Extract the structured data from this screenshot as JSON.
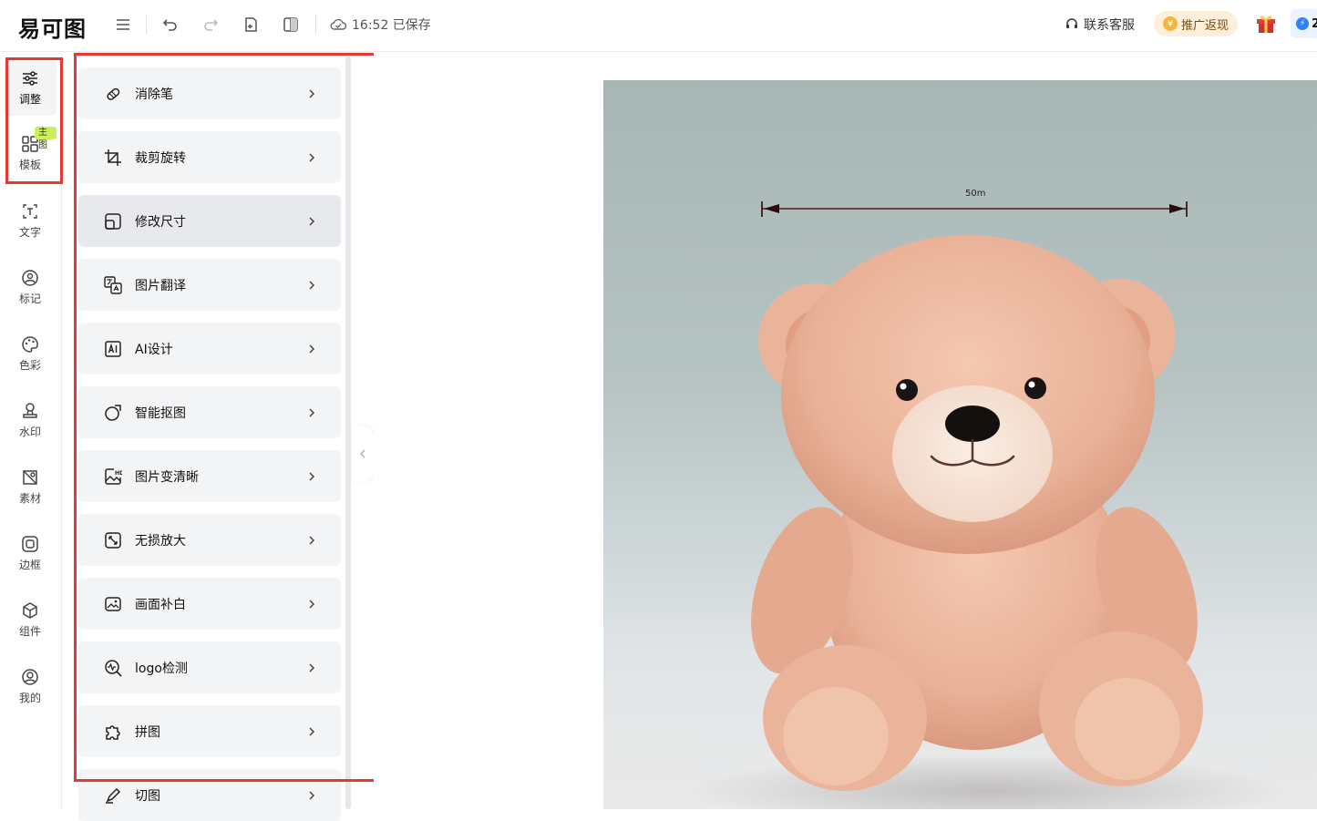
{
  "topbar": {
    "logo": "易可图",
    "save_time": "16:52 已保存",
    "support_label": "联系客服",
    "promo_label": "推广返现",
    "vip_number": "2"
  },
  "rail": {
    "items": [
      {
        "label": "调整",
        "icon": "sliders-icon",
        "active": true
      },
      {
        "label": "模板",
        "icon": "grid-icon",
        "badge": "主图"
      },
      {
        "label": "文字",
        "icon": "text-icon"
      },
      {
        "label": "标记",
        "icon": "mark-icon"
      },
      {
        "label": "色彩",
        "icon": "palette-icon"
      },
      {
        "label": "水印",
        "icon": "stamp-icon"
      },
      {
        "label": "素材",
        "icon": "material-icon"
      },
      {
        "label": "边框",
        "icon": "frame-icon"
      },
      {
        "label": "组件",
        "icon": "cube-icon"
      },
      {
        "label": "我的",
        "icon": "user-icon"
      }
    ]
  },
  "tools": [
    {
      "label": "消除笔",
      "icon": "eraser-icon"
    },
    {
      "label": "裁剪旋转",
      "icon": "crop-icon"
    },
    {
      "label": "修改尺寸",
      "icon": "resize-icon",
      "active": true
    },
    {
      "label": "图片翻译",
      "icon": "translate-icon"
    },
    {
      "label": "AI设计",
      "icon": "ai-icon"
    },
    {
      "label": "智能抠图",
      "icon": "cutout-icon"
    },
    {
      "label": "图片变清晰",
      "icon": "hd-icon"
    },
    {
      "label": "无损放大",
      "icon": "enlarge-icon"
    },
    {
      "label": "画面补白",
      "icon": "fill-icon"
    },
    {
      "label": "logo检测",
      "icon": "logo-detect-icon"
    },
    {
      "label": "拼图",
      "icon": "puzzle-icon"
    },
    {
      "label": "切图",
      "icon": "slice-icon"
    }
  ],
  "canvas": {
    "dimension_label": "50m"
  },
  "colors": {
    "highlight": "#e53935",
    "accent_badge": "#c9f05a",
    "promo_bg": "#fdefd9"
  }
}
